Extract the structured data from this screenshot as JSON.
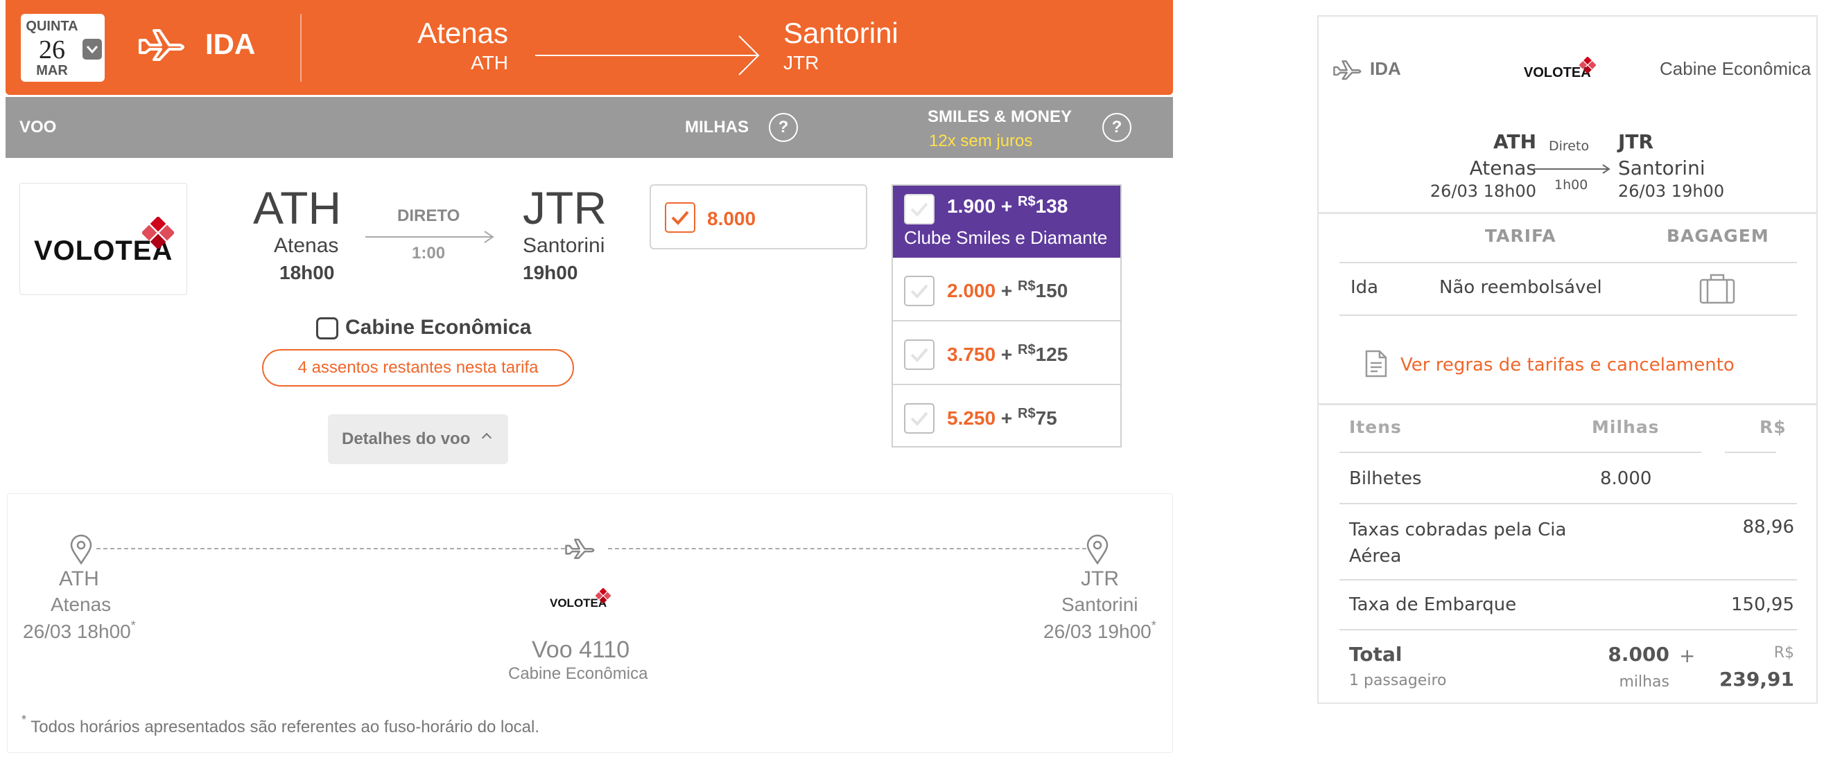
{
  "header": {
    "date": {
      "weekday": "QUINTA",
      "day": "26",
      "month": "MAR"
    },
    "direction": "IDA",
    "origin": {
      "city": "Atenas",
      "code": "ATH"
    },
    "destination": {
      "city": "Santorini",
      "code": "JTR"
    },
    "brand_color": "#ef672c"
  },
  "columns": {
    "voo": "VOO",
    "milhas": "MILHAS",
    "smiles_money": "SMILES & MONEY",
    "smiles_money_sub": "12x sem juros",
    "help": "?"
  },
  "flight": {
    "airline_logo": "VOLOTEA",
    "origin_code": "ATH",
    "origin_city": "Atenas",
    "origin_time": "18h00",
    "stop_label": "DIRETO",
    "duration": "1:00",
    "dest_code": "JTR",
    "dest_city": "Santorini",
    "dest_time": "19h00",
    "cabin": "Cabine Econômica",
    "seats_left": "4 assentos restantes nesta tarifa",
    "details_button": "Detalhes do voo"
  },
  "milhas_option": {
    "value": "8.000",
    "selected": true
  },
  "smiles_money_options": [
    {
      "miles": "1.900",
      "plus": " + ",
      "currency": "R$",
      "amount": "138",
      "subtitle": "Clube Smiles e Diamante",
      "highlight_color": "#5e3a9b"
    },
    {
      "miles": "2.000",
      "plus": " + ",
      "currency": "R$",
      "amount": "150"
    },
    {
      "miles": "3.750",
      "plus": " + ",
      "currency": "R$",
      "amount": "125"
    },
    {
      "miles": "5.250",
      "plus": " + ",
      "currency": "R$",
      "amount": "75"
    }
  ],
  "itinerary": {
    "origin_code": "ATH",
    "origin_city": "Atenas",
    "origin_datetime": "26/03 18h00",
    "dest_code": "JTR",
    "dest_city": "Santorini",
    "dest_datetime": "26/03 19h00",
    "asterisk": "*",
    "airline_logo": "VOLOTEA",
    "flight_number": "Voo 4110",
    "cabin": "Cabine Econômica",
    "note": "Todos horários apresentados são referentes ao fuso-horário do local."
  },
  "summary": {
    "direction": "IDA",
    "airline_logo": "VOLOTEA",
    "cabin": "Cabine Econômica",
    "origin_code": "ATH",
    "origin_city": "Atenas",
    "origin_datetime": "26/03 18h00",
    "stop_label": "Direto",
    "duration": "1h00",
    "dest_code": "JTR",
    "dest_city": "Santorini",
    "dest_datetime": "26/03 19h00",
    "fare_header": "TARIFA",
    "baggage_header": "BAGAGEM",
    "fare_row_label": "Ida",
    "fare_row_value": "Não reembolsável",
    "rules_link": "Ver regras de tarifas e cancelamento",
    "table_headers": {
      "items": "Itens",
      "miles": "Milhas",
      "brl": "R$"
    },
    "rows": [
      {
        "label": "Bilhetes",
        "miles": "8.000",
        "brl": ""
      },
      {
        "label": "Taxas cobradas pela Cia Aérea",
        "miles": "",
        "brl": "88,96"
      },
      {
        "label": "Taxa de Embarque",
        "miles": "",
        "brl": "150,95"
      }
    ],
    "total": {
      "label": "Total",
      "passengers": "1 passageiro",
      "miles": "8.000",
      "miles_unit": "milhas",
      "plus": "+",
      "currency": "R$",
      "brl": "239,91"
    }
  }
}
